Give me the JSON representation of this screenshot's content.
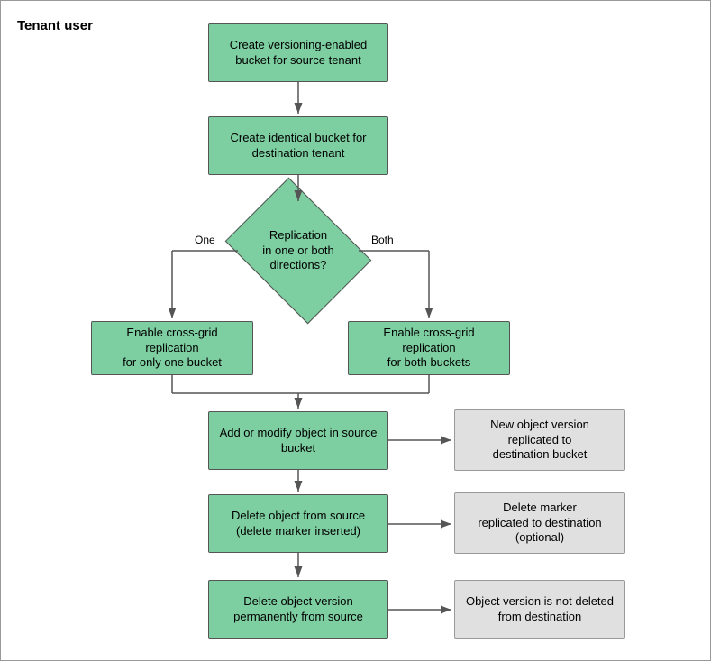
{
  "title": "Tenant\nuser",
  "boxes": {
    "box1": {
      "label": "Create versioning-enabled\nbucket for source tenant"
    },
    "box2": {
      "label": "Create identical bucket for\ndestination tenant"
    },
    "diamond": {
      "label": "Replication\nin one or both\ndirections?"
    },
    "diamond_one": {
      "label": "One"
    },
    "diamond_both": {
      "label": "Both"
    },
    "box3": {
      "label": "Enable cross-grid replication\nfor only one bucket"
    },
    "box4": {
      "label": "Enable cross-grid replication\nfor both buckets"
    },
    "box5": {
      "label": "Add or modify object in source\nbucket"
    },
    "box5_side": {
      "label": "New object version\nreplicated to\ndestination bucket"
    },
    "box6": {
      "label": "Delete object from source\n(delete marker inserted)"
    },
    "box6_side": {
      "label": "Delete marker\nreplicated to destination\n(optional)"
    },
    "box7": {
      "label": "Delete object version\npermanently from source"
    },
    "box7_side": {
      "label": "Object version is not deleted\nfrom destination"
    }
  }
}
